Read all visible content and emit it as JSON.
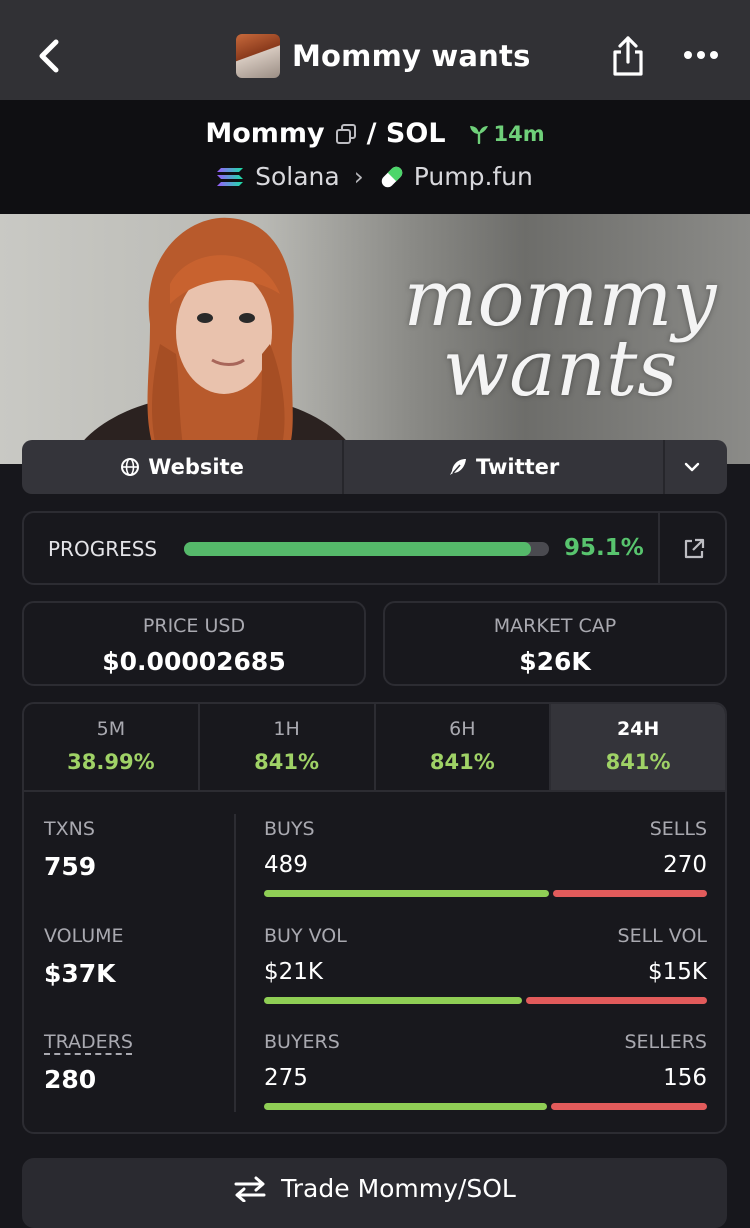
{
  "nav": {
    "title": "Mommy wants"
  },
  "pair": {
    "base": "Mommy",
    "quote": "/ SOL",
    "age": "14m",
    "chain": "Solana",
    "dex": "Pump.fun"
  },
  "banner": {
    "line1": "mommy",
    "line2": "wants"
  },
  "links": {
    "website": "Website",
    "twitter": "Twitter"
  },
  "progress": {
    "label": "PROGRESS",
    "value": "95.1%",
    "fraction": 0.951
  },
  "stats": {
    "price": {
      "label": "PRICE USD",
      "value": "$0.00002685"
    },
    "mcap": {
      "label": "MARKET CAP",
      "value": "$26K"
    }
  },
  "timeframes": [
    {
      "label": "5M",
      "value": "38.99%"
    },
    {
      "label": "1H",
      "value": "841%"
    },
    {
      "label": "6H",
      "value": "841%"
    },
    {
      "label": "24H",
      "value": "841%"
    }
  ],
  "metrics": {
    "txns": {
      "label": "TXNS",
      "value": "759"
    },
    "volume": {
      "label": "VOLUME",
      "value": "$37K"
    },
    "traders": {
      "label": "TRADERS",
      "value": "280"
    }
  },
  "splits": {
    "txns": {
      "left_label": "BUYS",
      "left_value": "489",
      "right_label": "SELLS",
      "right_value": "270",
      "buy_share": 0.644
    },
    "volume": {
      "left_label": "BUY VOL",
      "left_value": "$21K",
      "right_label": "SELL VOL",
      "right_value": "$15K",
      "buy_share": 0.583
    },
    "traders": {
      "left_label": "BUYERS",
      "left_value": "275",
      "right_label": "SELLERS",
      "right_value": "156",
      "buy_share": 0.638
    }
  },
  "trade": {
    "label": "Trade Mommy/SOL"
  },
  "colors": {
    "buy": "#8fce55",
    "sell": "#e25b5b",
    "progress": "#55b86a",
    "accent_green": "#9fd266"
  },
  "icons": {
    "back": "chevron-left-icon",
    "share": "share-icon",
    "more": "more-horizontal-icon",
    "copy": "copy-icon",
    "age": "seedling-icon",
    "chain": "solana-icon",
    "dex": "pill-icon",
    "website": "globe-icon",
    "twitter": "feather-icon",
    "external": "external-link-icon",
    "trade": "swap-icon"
  }
}
